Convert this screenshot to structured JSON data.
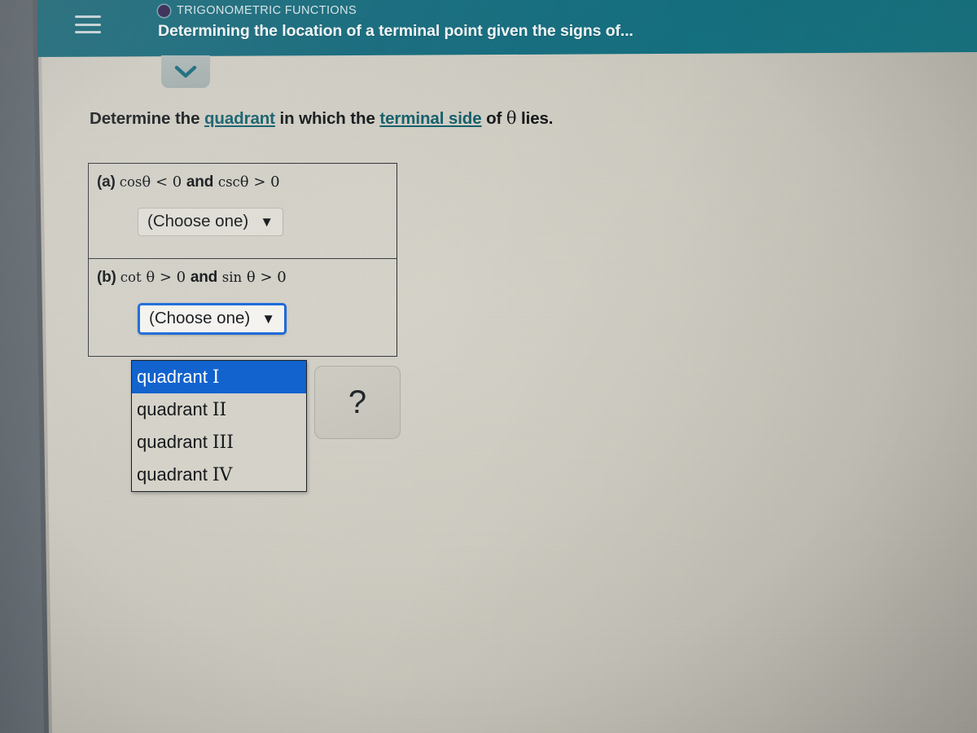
{
  "header": {
    "menu_icon": "hamburger-icon",
    "eyebrow_icon": "circle-icon",
    "eyebrow": "TRIGONOMETRIC FUNCTIONS",
    "title": "Determining the location of a terminal point given the signs of...",
    "background_color": "#11687a",
    "collapse_icon": "chevron-down-icon"
  },
  "question": {
    "prompt_before": "Determine the ",
    "prompt_link1": "quadrant",
    "prompt_middle": " in which the ",
    "prompt_link2": "terminal side",
    "prompt_after": " of ",
    "prompt_theta": "θ",
    "prompt_end": " lies.",
    "link_color": "#0e5b68",
    "parts": [
      {
        "label": "(a)",
        "expression": "cosθ < 0 and cscθ > 0",
        "expr_fn1": "cos",
        "expr_theta1": "θ",
        "expr_rel1": " < 0 ",
        "expr_and": "and",
        "expr_fn2": "csc",
        "expr_theta2": "θ",
        "expr_rel2": " > 0",
        "select_value": "(Choose one)",
        "select_caret": "▼",
        "focused": false
      },
      {
        "label": "(b)",
        "expression": "cotθ > 0 and sinθ > 0",
        "expr_fn1": "cot",
        "expr_theta1": "θ",
        "expr_rel1": " > 0 ",
        "expr_and": "and",
        "expr_fn2": "sin",
        "expr_theta2": "θ",
        "expr_rel2": " > 0",
        "select_value": "(Choose one)",
        "select_caret": "▼",
        "focused": true
      }
    ]
  },
  "dropdown": {
    "open": true,
    "highlight_color": "#1263ce",
    "options": [
      {
        "word": "quadrant",
        "roman": "I",
        "selected": true
      },
      {
        "word": "quadrant",
        "roman": "II",
        "selected": false
      },
      {
        "word": "quadrant",
        "roman": "III",
        "selected": false
      },
      {
        "word": "quadrant",
        "roman": "IV",
        "selected": false
      }
    ]
  },
  "help": {
    "icon": "question-mark-icon",
    "label": "?"
  }
}
